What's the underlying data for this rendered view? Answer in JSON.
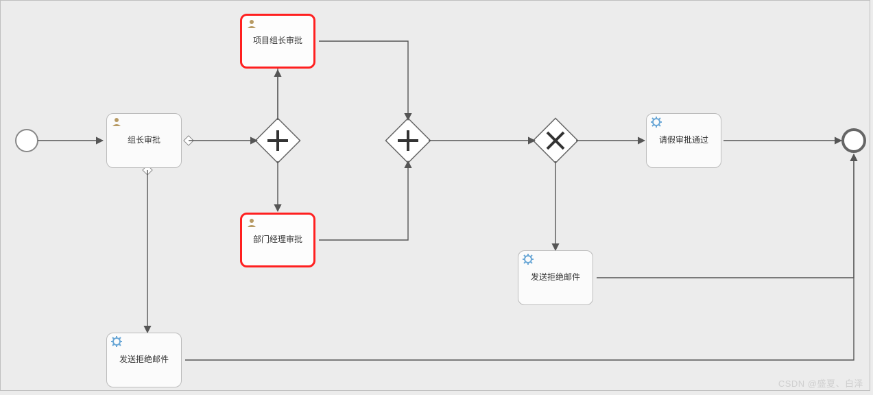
{
  "watermark": "CSDN @盛夏、白泽",
  "tasks": {
    "group_leader": {
      "label": "组长审批",
      "type": "user",
      "highlight": false
    },
    "project_leader": {
      "label": "项目组长审批",
      "type": "user",
      "highlight": true
    },
    "dept_manager": {
      "label": "部门经理审批",
      "type": "user",
      "highlight": true
    },
    "approve_mail": {
      "label": "请假审批通过",
      "type": "service",
      "highlight": false
    },
    "reject_mail_top": {
      "label": "发送拒绝邮件",
      "type": "service",
      "highlight": false
    },
    "reject_mail_btm": {
      "label": "发送拒绝邮件",
      "type": "service",
      "highlight": false
    }
  }
}
